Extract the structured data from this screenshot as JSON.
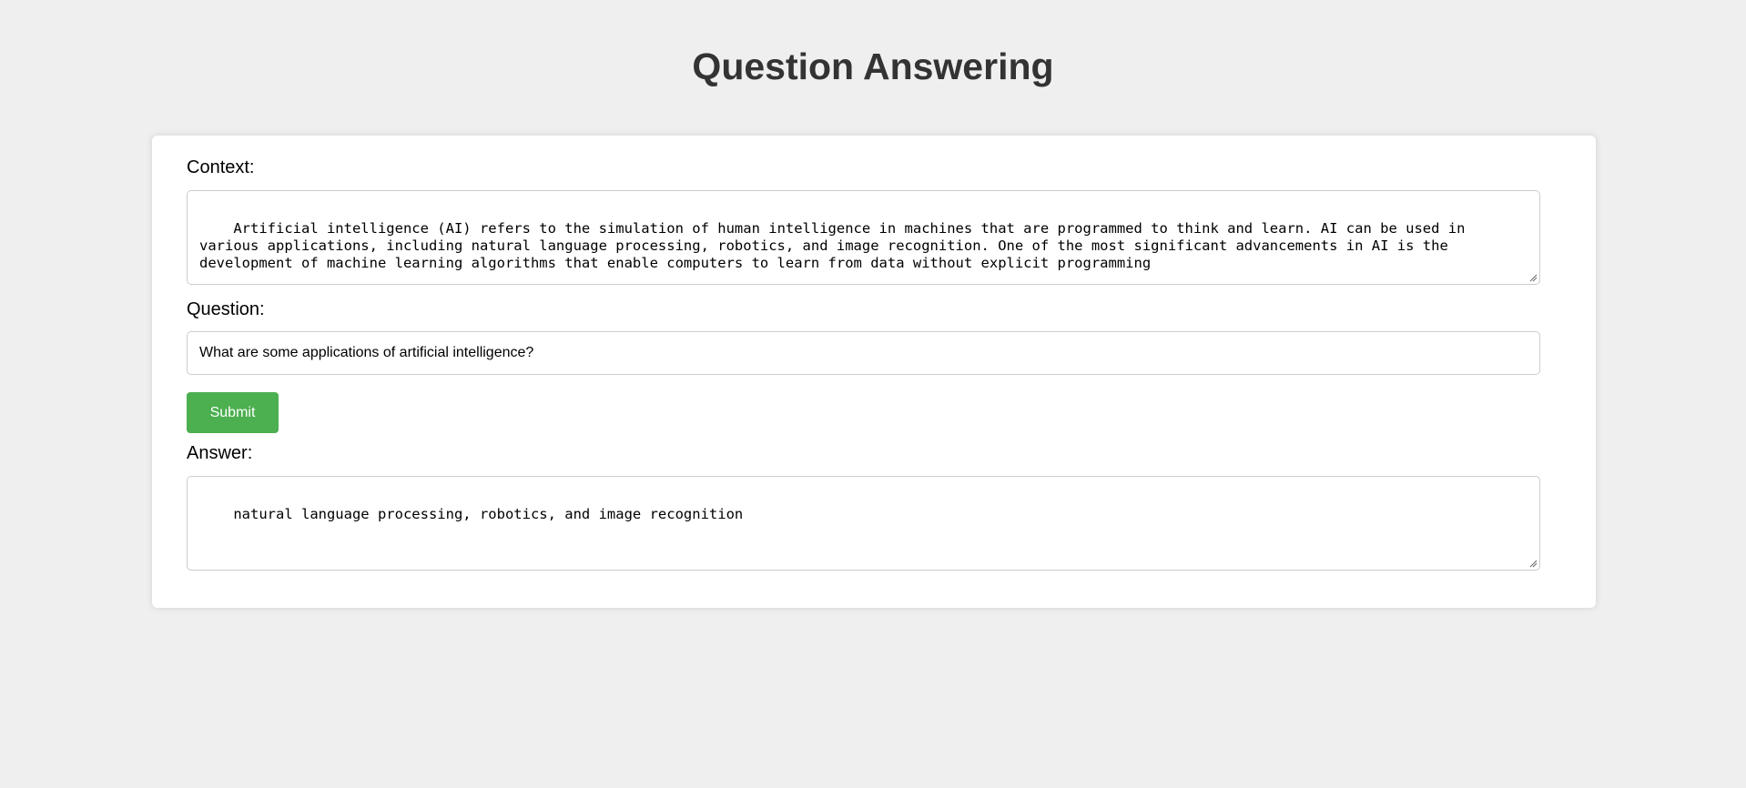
{
  "header": {
    "title": "Question Answering"
  },
  "form": {
    "context_label": "Context:",
    "context_value": "Artificial intelligence (AI) refers to the simulation of human intelligence in machines that are programmed to think and learn. AI can be used in various applications, including natural language processing, robotics, and image recognition. One of the most significant advancements in AI is the development of machine learning algorithms that enable computers to learn from data without explicit programming",
    "question_label": "Question:",
    "question_value": "What are some applications of artificial intelligence?",
    "submit_label": "Submit",
    "answer_label": "Answer:",
    "answer_value": "natural language processing, robotics, and image recognition"
  },
  "colors": {
    "background": "#efefef",
    "card": "#ffffff",
    "title": "#333333",
    "submit_button": "#4caf50",
    "border": "#cccccc"
  }
}
